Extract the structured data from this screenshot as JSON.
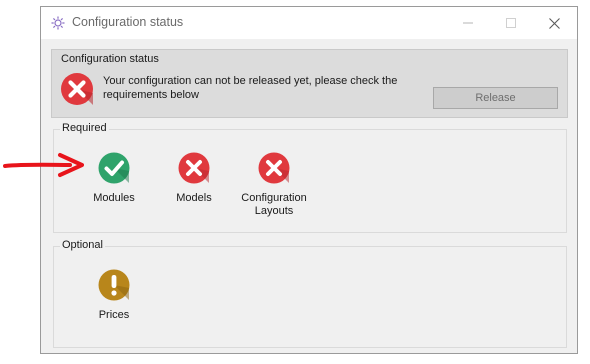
{
  "window": {
    "title": "Configuration status",
    "controls": {
      "minimize": "minimize-icon",
      "maximize": "maximize-icon",
      "close": "close-icon"
    }
  },
  "status": {
    "heading": "Configuration status",
    "icon": "error-icon",
    "message": "Your configuration can not be released yet, please check the requirements below",
    "release_label": "Release"
  },
  "required": {
    "label": "Required",
    "items": [
      {
        "label": "Modules",
        "state": "ok",
        "icon": "check-icon"
      },
      {
        "label": "Models",
        "state": "error",
        "icon": "error-icon"
      },
      {
        "label": "Configuration Layouts",
        "state": "error",
        "icon": "error-icon"
      }
    ]
  },
  "optional": {
    "label": "Optional",
    "items": [
      {
        "label": "Prices",
        "state": "warning",
        "icon": "warning-icon"
      }
    ]
  },
  "colors": {
    "ok": "#2fa36b",
    "error": "#e0393e",
    "warning": "#b8861b",
    "arrow": "#e8141b"
  }
}
